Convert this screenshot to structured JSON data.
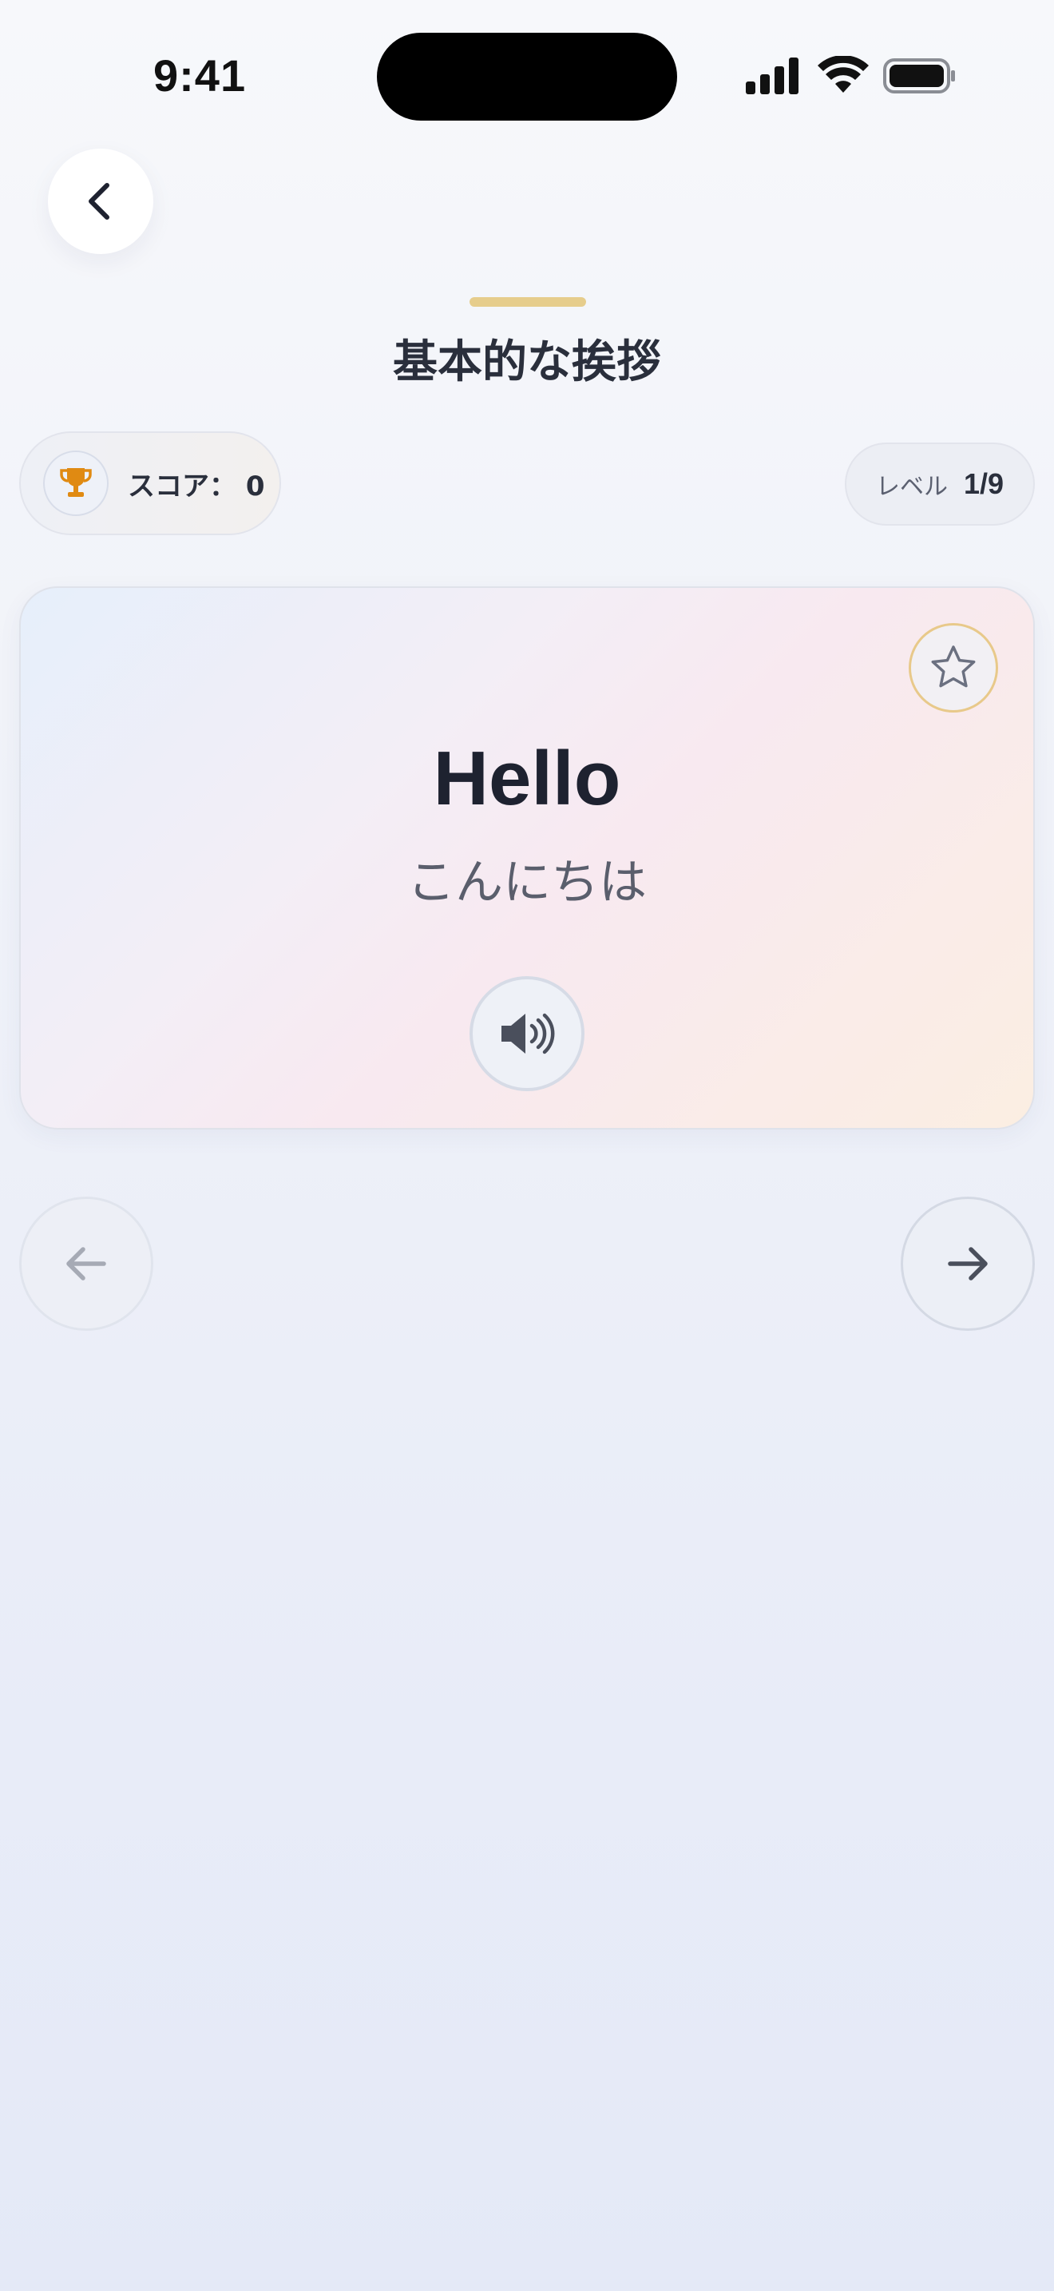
{
  "status_bar": {
    "time": "9:41",
    "icons": [
      "cellular-signal-icon",
      "wifi-icon",
      "battery-icon"
    ]
  },
  "header": {
    "back_icon": "chevron-left-icon",
    "title": "基本的な挨拶"
  },
  "score": {
    "icon": "trophy-icon",
    "label": "スコア：",
    "value": "0"
  },
  "level": {
    "label": "レベル",
    "value": "1/9"
  },
  "card": {
    "word": "Hello",
    "translation": "こんにちは",
    "favorite_icon": "star-outline-icon",
    "audio_icon": "speaker-icon"
  },
  "navigation": {
    "prev_icon": "arrow-left-icon",
    "next_icon": "arrow-right-icon"
  },
  "colors": {
    "accent": "#e6cd8c",
    "trophy": "#e08a12",
    "text_primary": "#1e2230",
    "text_secondary": "#5a5e6c"
  }
}
